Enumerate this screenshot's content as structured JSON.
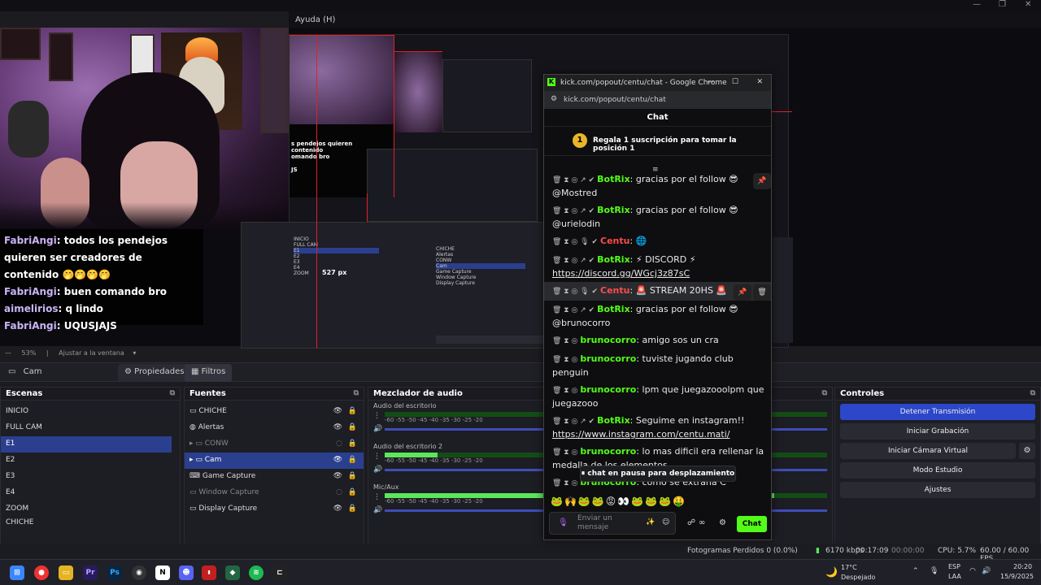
{
  "obs": {
    "menu_help": "Ayuda (H)",
    "zoom": "53%",
    "fit": "Ajustar a la ventana",
    "current_source": "Cam",
    "properties": "Propiedades",
    "filters": "Filtros",
    "scenes_title": "Escenas",
    "scenes": [
      "INICIO",
      "FULL CAM",
      "E1",
      "E2",
      "E3",
      "E4",
      "ZOOM",
      "CHICHE"
    ],
    "sources_title": "Fuentes",
    "sources": [
      "CHICHE",
      "Alertas",
      "CONW",
      "Cam",
      "Game Capture",
      "Window Capture",
      "Display Capture"
    ],
    "mixer_title": "Mezclador de audio",
    "mixer": [
      "Audio del escritorio",
      "Audio del escritorio 2",
      "Mic/Aux"
    ],
    "mixer_ticks": "-60  -55  -50  -45  -40  -35  -30  -25  -20",
    "controls_title": "Controles",
    "controls": [
      "Detener Transmisión",
      "Iniciar Grabación",
      "Iniciar Cámara Virtual",
      "Modo Estudio",
      "Ajustes"
    ],
    "status": {
      "dropped": "Fotogramas Perdidos 0 (0.0%)",
      "bitrate": "6170 kbps",
      "live_time": "00:17:09",
      "rec_time": "00:00:00",
      "cpu": "CPU: 5.7%",
      "fps": "60.00 / 60.00 FPS"
    },
    "preview_px": "527 px"
  },
  "overlay_chat": [
    {
      "user": "FabriAngi",
      "text": ": todos los pendejos quieren ser creadores de contenido 🤭🤭🤭🤭"
    },
    {
      "user": "FabriAngi",
      "text": ": buen comando bro"
    },
    {
      "user": "aimelirios",
      "text": ": q lindo"
    },
    {
      "user": "FabriAngi",
      "text": ": UQUSJAJS"
    }
  ],
  "chrome": {
    "title": "kick.com/popout/centu/chat - Google Chrome",
    "url": "kick.com/popout/centu/chat",
    "header": "Chat",
    "promo": "Regala 1 suscripción para tomar la posición 1",
    "promo_badge": "1",
    "messages": [
      {
        "user": "BotRix",
        "cls": "u-bot",
        "text": ": gracias por el follow 😎 @Mostred"
      },
      {
        "user": "BotRix",
        "cls": "u-bot",
        "text": ": gracias por el follow 😎 @urielodin"
      },
      {
        "user": "Centu",
        "cls": "u-red",
        "text": ": 🌐"
      },
      {
        "user": "BotRix",
        "cls": "u-bot",
        "text": ": ⚡ DISCORD ⚡ ",
        "link": "https://discord.gg/WGcj3z87sC"
      },
      {
        "user": "Centu",
        "cls": "u-red",
        "text": ": 🚨 STREAM 20HS 🚨",
        "hl": true
      },
      {
        "user": "BotRix",
        "cls": "u-bot",
        "text": ": gracias por el follow 😎 @brunocorro"
      },
      {
        "user": "brunocorro",
        "cls": "u-green",
        "text": ": amigo sos un cra"
      },
      {
        "user": "brunocorro",
        "cls": "u-green",
        "text": ": tuviste jugando club penguin"
      },
      {
        "user": "brunocorro",
        "cls": "u-green",
        "text": ": lpm que juegazooolpm que juegazooo"
      },
      {
        "user": "BotRix",
        "cls": "u-bot",
        "text": ": Seguime en instagram!! ",
        "link": "https://www.instagram.com/centu.mati/"
      },
      {
        "user": "brunocorro",
        "cls": "u-green",
        "text": ": lo mas dificil era rellenar la medalla de los elementos"
      },
      {
        "user": "brunocorro",
        "cls": "u-green",
        "text": ": como se extraña C"
      }
    ],
    "paused": "chat en pausa para desplazamiento",
    "placeholder": "Enviar un mensaje",
    "send": "Chat"
  },
  "taskbar": {
    "weather_temp": "17°C",
    "weather_desc": "Despejado",
    "lang1": "ESP",
    "lang2": "LAA",
    "time": "20:20",
    "date": "15/9/2025"
  }
}
